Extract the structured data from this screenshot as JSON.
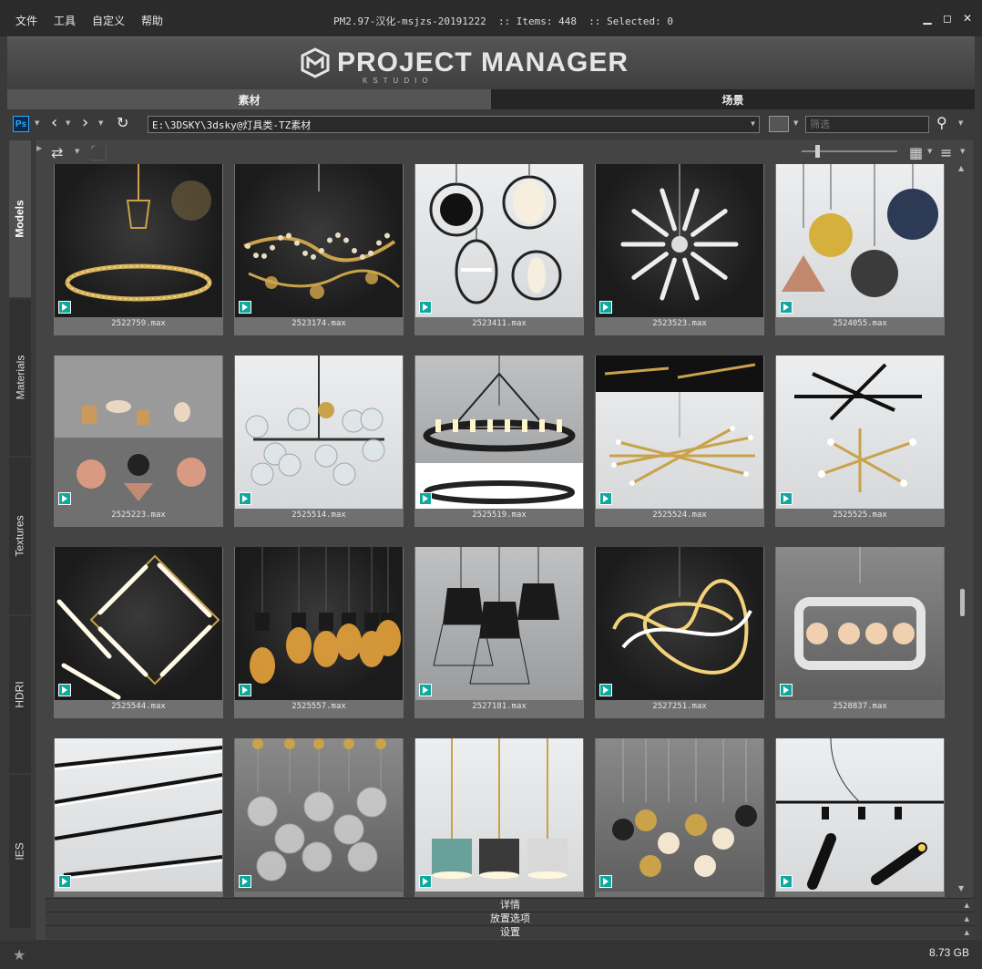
{
  "menu": [
    "文件",
    "工具",
    "自定义",
    "帮助"
  ],
  "title_text": "PM2.97-汉化-msjzs-20191222  :: Items: 448  :: Selected: 0",
  "window_controls": [
    "minimize-icon",
    "maximize-icon",
    "close-icon"
  ],
  "logo": {
    "text": "PROJECT MANAGER",
    "sub": "KSTUDIO"
  },
  "top_tabs": [
    {
      "label": "素材",
      "active": true
    },
    {
      "label": "场景",
      "active": false
    }
  ],
  "toolbar": {
    "ps_label": "Ps",
    "path_value": "E:\\3DSKY\\3dsky@灯具类-TZ素材",
    "filter_placeholder": "筛选"
  },
  "side_tabs": [
    {
      "label": "Models",
      "active": true
    },
    {
      "label": "Materials",
      "active": false
    },
    {
      "label": "Textures",
      "active": false
    },
    {
      "label": "HDRI",
      "active": false
    },
    {
      "label": "IES",
      "active": false
    }
  ],
  "grid_items": [
    {
      "label": "2522759.max",
      "theme": "dark",
      "art": "ring"
    },
    {
      "label": "2523174.max",
      "theme": "dark",
      "art": "branch"
    },
    {
      "label": "2523411.max",
      "theme": "light",
      "art": "ovals"
    },
    {
      "label": "2523523.max",
      "theme": "dark",
      "art": "sputnik"
    },
    {
      "label": "2524055.max",
      "theme": "light",
      "art": "cones"
    },
    {
      "label": "2525223.max",
      "theme": "grey",
      "art": "collage"
    },
    {
      "label": "2525514.max",
      "theme": "light",
      "art": "globes"
    },
    {
      "label": "2525519.max",
      "theme": "mid",
      "art": "wheel"
    },
    {
      "label": "2525524.max",
      "theme": "light",
      "art": "sticks"
    },
    {
      "label": "2525525.max",
      "theme": "light",
      "art": "sticks2"
    },
    {
      "label": "2525544.max",
      "theme": "dark",
      "art": "diamond"
    },
    {
      "label": "2525557.max",
      "theme": "dark",
      "art": "bulbs"
    },
    {
      "label": "2527181.max",
      "theme": "mid",
      "art": "cages"
    },
    {
      "label": "2527251.max",
      "theme": "dark",
      "art": "knot"
    },
    {
      "label": "2528837.max",
      "theme": "grey",
      "art": "frame"
    },
    {
      "label": "",
      "theme": "light",
      "art": "lines"
    },
    {
      "label": "",
      "theme": "grey",
      "art": "bubbles"
    },
    {
      "label": "",
      "theme": "light",
      "art": "domes"
    },
    {
      "label": "",
      "theme": "grey",
      "art": "mix"
    },
    {
      "label": "",
      "theme": "light",
      "art": "spots"
    }
  ],
  "accordion": [
    "详情",
    "放置选项",
    "设置"
  ],
  "status": {
    "size": "8.73 GB"
  }
}
